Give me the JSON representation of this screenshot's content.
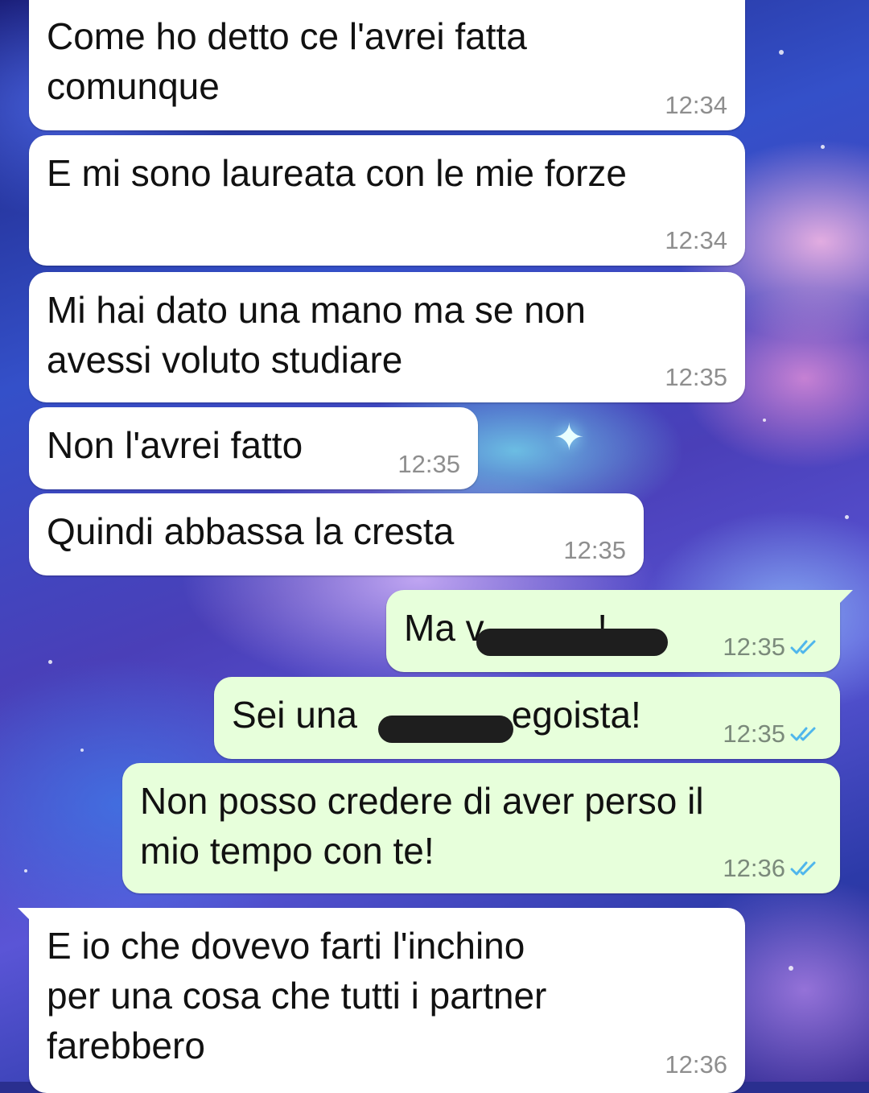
{
  "chat": {
    "messages": [
      {
        "direction": "incoming",
        "text": "Come ho detto ce l'avrei fatta\ncomunque",
        "time": "12:34"
      },
      {
        "direction": "incoming",
        "text": "E mi sono laureata con le mie forze",
        "time": "12:34"
      },
      {
        "direction": "incoming",
        "text": "Mi hai dato una mano ma se non\navessi voluto studiare",
        "time": "12:35"
      },
      {
        "direction": "incoming",
        "text": "Non l'avrei fatto",
        "time": "12:35"
      },
      {
        "direction": "incoming",
        "text": "Quindi abbassa la cresta",
        "time": "12:35"
      },
      {
        "direction": "outgoing",
        "text": "Ma v           !",
        "time": "12:35",
        "status": "read-double-tick-icon",
        "redacted": true
      },
      {
        "direction": "outgoing",
        "text": "Sei una               egoista!",
        "time": "12:35",
        "status": "read-double-tick-icon",
        "redacted": true
      },
      {
        "direction": "outgoing",
        "text": "Non posso credere di aver perso il\nmio tempo con te!",
        "time": "12:36",
        "status": "read-double-tick-icon"
      },
      {
        "direction": "incoming",
        "text": "E io che dovevo farti l'inchino\nper una cosa che tutti i partner\nfarebbero",
        "time": "12:36"
      }
    ]
  },
  "colors": {
    "incoming_bubble": "#ffffff",
    "outgoing_bubble": "#e7ffdb",
    "read_tick": "#4fb6ec",
    "timestamp": "#8e8e8e"
  }
}
